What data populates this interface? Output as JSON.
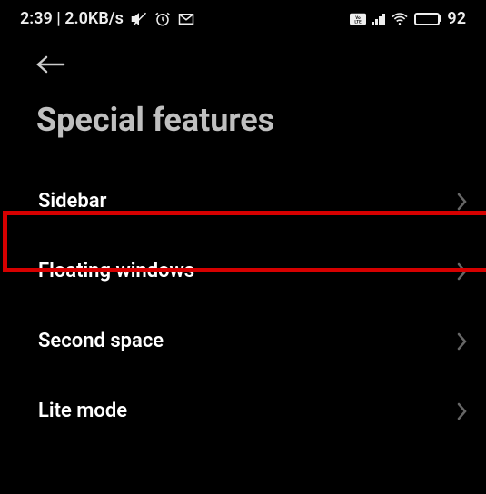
{
  "status_bar": {
    "time": "2:39",
    "network_speed": "2.0KB/s",
    "battery_text": "92",
    "icons": {
      "mute": "mute-icon",
      "alarm": "alarm-icon",
      "gmail": "gmail-icon",
      "volte": "volte-icon",
      "signal": "signal-icon",
      "wifi": "wifi-icon",
      "battery": "battery-icon"
    }
  },
  "page_title": "Special features",
  "menu": [
    {
      "label": "Sidebar",
      "highlighted": true
    },
    {
      "label": "Floating windows",
      "highlighted": false
    },
    {
      "label": "Second space",
      "highlighted": false
    },
    {
      "label": "Lite mode",
      "highlighted": false
    }
  ]
}
